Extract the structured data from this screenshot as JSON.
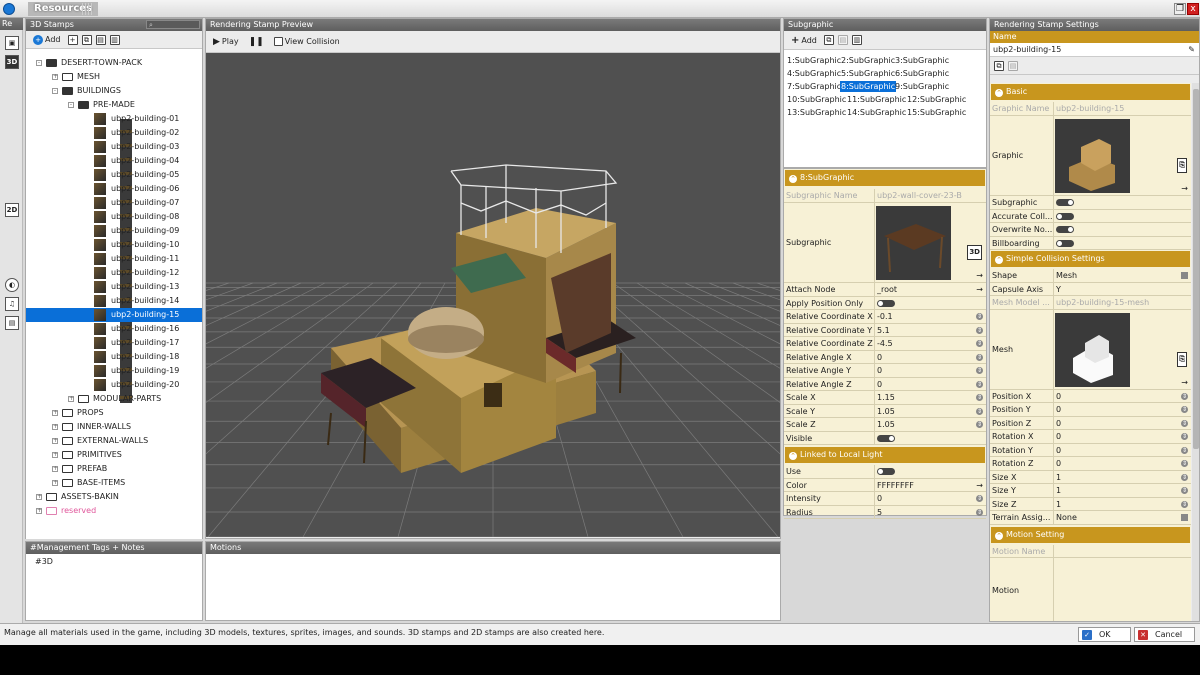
{
  "window": {
    "title": "Resources",
    "restore_icon": "restore-icon",
    "close_label": "x"
  },
  "stamps_panel": {
    "header": "3D Stamps",
    "side_header": "Re",
    "toolbar": {
      "add_label": "Add"
    },
    "tree": [
      {
        "label": "DESERT-TOWN-PACK",
        "depth": 1,
        "expand": "-",
        "kind": "folder-open"
      },
      {
        "label": "MESH",
        "depth": 2,
        "expand": "+",
        "kind": "folder"
      },
      {
        "label": "BUILDINGS",
        "depth": 2,
        "expand": "-",
        "kind": "folder-open"
      },
      {
        "label": "PRE-MADE",
        "depth": 3,
        "expand": "-",
        "kind": "folder-open"
      },
      {
        "label": "ubp2-building-01",
        "depth": 4,
        "kind": "item"
      },
      {
        "label": "ubp2-building-02",
        "depth": 4,
        "kind": "item"
      },
      {
        "label": "ubp2-building-03",
        "depth": 4,
        "kind": "item"
      },
      {
        "label": "ubp2-building-04",
        "depth": 4,
        "kind": "item"
      },
      {
        "label": "ubp2-building-05",
        "depth": 4,
        "kind": "item"
      },
      {
        "label": "ubp2-building-06",
        "depth": 4,
        "kind": "item"
      },
      {
        "label": "ubp2-building-07",
        "depth": 4,
        "kind": "item"
      },
      {
        "label": "ubp2-building-08",
        "depth": 4,
        "kind": "item"
      },
      {
        "label": "ubp2-building-09",
        "depth": 4,
        "kind": "item"
      },
      {
        "label": "ubp2-building-10",
        "depth": 4,
        "kind": "item"
      },
      {
        "label": "ubp2-building-11",
        "depth": 4,
        "kind": "item"
      },
      {
        "label": "ubp2-building-12",
        "depth": 4,
        "kind": "item"
      },
      {
        "label": "ubp2-building-13",
        "depth": 4,
        "kind": "item"
      },
      {
        "label": "ubp2-building-14",
        "depth": 4,
        "kind": "item"
      },
      {
        "label": "ubp2-building-15",
        "depth": 4,
        "kind": "item",
        "selected": true
      },
      {
        "label": "ubp2-building-16",
        "depth": 4,
        "kind": "item"
      },
      {
        "label": "ubp2-building-17",
        "depth": 4,
        "kind": "item"
      },
      {
        "label": "ubp2-building-18",
        "depth": 4,
        "kind": "item"
      },
      {
        "label": "ubp2-building-19",
        "depth": 4,
        "kind": "item"
      },
      {
        "label": "ubp2-building-20",
        "depth": 4,
        "kind": "item"
      },
      {
        "label": "MODULAR-PARTS",
        "depth": 3,
        "expand": "+",
        "kind": "folder"
      },
      {
        "label": "PROPS",
        "depth": 2,
        "expand": "+",
        "kind": "folder"
      },
      {
        "label": "INNER-WALLS",
        "depth": 2,
        "expand": "+",
        "kind": "folder"
      },
      {
        "label": "EXTERNAL-WALLS",
        "depth": 2,
        "expand": "+",
        "kind": "folder"
      },
      {
        "label": "PRIMITIVES",
        "depth": 2,
        "expand": "+",
        "kind": "folder"
      },
      {
        "label": "PREFAB",
        "depth": 2,
        "expand": "+",
        "kind": "folder"
      },
      {
        "label": "BASE-ITEMS",
        "depth": 2,
        "expand": "+",
        "kind": "folder"
      },
      {
        "label": "ASSETS-BAKIN",
        "depth": 1,
        "expand": "+",
        "kind": "folder"
      },
      {
        "label": "reserved",
        "depth": 1,
        "expand": "+",
        "kind": "reserved"
      }
    ],
    "tags_header": "#Management Tags + Notes",
    "tags_value": "#3D"
  },
  "preview_panel": {
    "header": "Rendering Stamp Preview",
    "play_label": "Play",
    "view_collision_label": "View Collision",
    "motions_header": "Motions"
  },
  "subgraphic_panel": {
    "header": "Subgraphic",
    "add_label": "Add",
    "list": [
      [
        "1:SubGraphic",
        "2:SubGraphic",
        "3:SubGraphic"
      ],
      [
        "4:SubGraphic",
        "5:SubGraphic",
        "6:SubGraphic"
      ],
      [
        "7:SubGraphic",
        "8:SubGraphic",
        "9:SubGraphic"
      ],
      [
        "10:SubGraphic",
        "11:SubGraphic",
        "12:SubGraphic"
      ],
      [
        "13:SubGraphic",
        "14:SubGraphic",
        "15:SubGraphic"
      ]
    ],
    "selected": "8:SubGraphic",
    "section_title": "8:SubGraphic",
    "name_key": "Subgraphic Name",
    "name_value": "ubp2-wall-cover-23-B",
    "image_key": "Subgraphic",
    "image_badge": "3D",
    "rows": [
      {
        "k": "Attach Node",
        "v": "_root",
        "t": "arrow"
      },
      {
        "k": "Apply Position Only",
        "t": "toggle-off"
      },
      {
        "k": "Relative Coordinate X",
        "v": "-0.1",
        "t": "num"
      },
      {
        "k": "Relative Coordinate Y",
        "v": "5.1",
        "t": "num"
      },
      {
        "k": "Relative Coordinate Z",
        "v": "-4.5",
        "t": "num"
      },
      {
        "k": "Relative Angle X",
        "v": "0",
        "t": "num"
      },
      {
        "k": "Relative Angle Y",
        "v": "0",
        "t": "num"
      },
      {
        "k": "Relative Angle Z",
        "v": "0",
        "t": "num"
      },
      {
        "k": "Scale X",
        "v": "1.15",
        "t": "num"
      },
      {
        "k": "Scale Y",
        "v": "1.05",
        "t": "num"
      },
      {
        "k": "Scale Z",
        "v": "1.05",
        "t": "num"
      },
      {
        "k": "Visible",
        "t": "toggle-on"
      }
    ],
    "light_title": "Linked to Local Light",
    "light_rows": [
      {
        "k": "Use",
        "t": "toggle-off"
      },
      {
        "k": "Color",
        "v": "FFFFFFFF",
        "t": "arrow"
      },
      {
        "k": "Intensity",
        "v": "0",
        "t": "num"
      },
      {
        "k": "Radius",
        "v": "5",
        "t": "num"
      }
    ]
  },
  "settings_panel": {
    "header": "Rendering Stamp Settings",
    "name_label": "Name",
    "name_value": "ubp2-building-15",
    "basic_title": "Basic",
    "graphic_name_key": "Graphic Name",
    "graphic_name_value": "ubp2-building-15",
    "graphic_key": "Graphic",
    "toggles": [
      {
        "k": "Subgraphic",
        "t": "toggle-on"
      },
      {
        "k": "Accurate Coll...",
        "t": "toggle-off"
      },
      {
        "k": "Overwrite No...",
        "t": "toggle-on"
      },
      {
        "k": "Billboarding",
        "t": "toggle-off"
      }
    ],
    "collision_title": "Simple Collision Settings",
    "collision_rows": [
      {
        "k": "Shape",
        "v": "Mesh"
      },
      {
        "k": "Capsule Axis",
        "v": "Y"
      }
    ],
    "mesh_model_key": "Mesh Model ...",
    "mesh_model_value": "ubp2-building-15-mesh",
    "mesh_key": "Mesh",
    "transform_rows": [
      {
        "k": "Position X",
        "v": "0"
      },
      {
        "k": "Position Y",
        "v": "0"
      },
      {
        "k": "Position Z",
        "v": "0"
      },
      {
        "k": "Rotation X",
        "v": "0"
      },
      {
        "k": "Rotation Y",
        "v": "0"
      },
      {
        "k": "Rotation Z",
        "v": "0"
      },
      {
        "k": "Size X",
        "v": "1"
      },
      {
        "k": "Size Y",
        "v": "1"
      },
      {
        "k": "Size Z",
        "v": "1"
      },
      {
        "k": "Terrain Assig...",
        "v": "None"
      }
    ],
    "motion_title": "Motion Setting",
    "motion_name_key": "Motion Name",
    "motion_key": "Motion"
  },
  "status": {
    "text": "Manage all materials used in the game, including 3D models, textures, sprites, images, and sounds. 3D stamps and 2D stamps are also created here.",
    "ok_label": "OK",
    "cancel_label": "Cancel"
  },
  "colors": {
    "accent": "#c8961e",
    "selection": "#0a6fd8",
    "property_bg": "#f7f1d6",
    "viewport_bg": "#505050"
  }
}
